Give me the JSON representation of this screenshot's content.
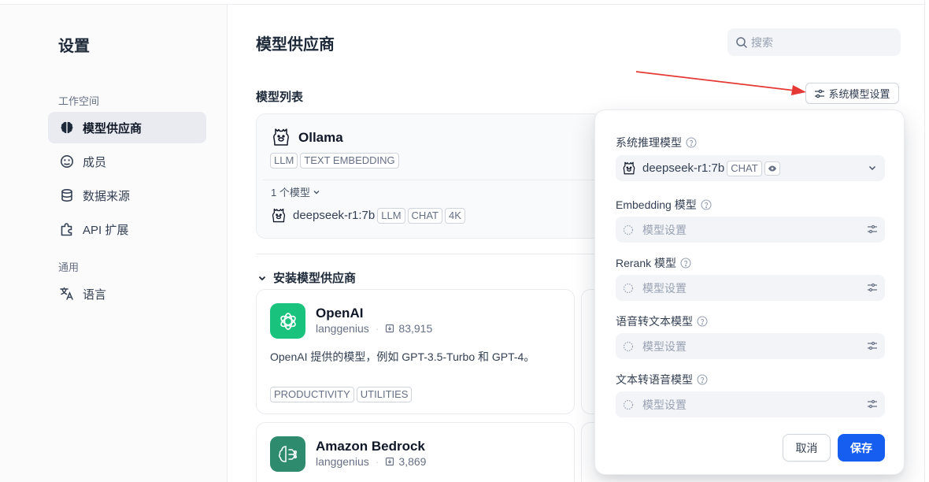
{
  "colors": {
    "accent": "#155eef",
    "arrow": "#e53935",
    "openai": "#19c37d",
    "bedrock": "#2e8b6e"
  },
  "sidebar": {
    "title": "设置",
    "group_workspace": "工作空间",
    "group_general": "通用",
    "items": [
      {
        "label": "模型供应商",
        "icon": "brain-icon"
      },
      {
        "label": "成员",
        "icon": "members-icon"
      },
      {
        "label": "数据来源",
        "icon": "database-icon"
      },
      {
        "label": "API 扩展",
        "icon": "puzzle-icon"
      },
      {
        "label": "语言",
        "icon": "translate-icon"
      }
    ]
  },
  "main": {
    "title": "模型供应商",
    "search_placeholder": "搜索",
    "model_list_label": "模型列表",
    "system_model_button": "系统模型设置",
    "ollama": {
      "name": "Ollama",
      "tags": [
        "LLM",
        "TEXT EMBEDDING"
      ],
      "model_count": "1 个模型",
      "model": {
        "name": "deepseek-r1:7b",
        "tags": [
          "LLM",
          "CHAT",
          "4K"
        ]
      }
    },
    "install_label": "安装模型供应商",
    "providers": [
      {
        "name": "OpenAI",
        "author": "langgenius",
        "downloads": "83,915",
        "description": "OpenAI 提供的模型，例如 GPT-3.5-Turbo 和 GPT-4。",
        "tags": [
          "PRODUCTIVITY",
          "UTILITIES"
        ]
      },
      {
        "name": "Amazon Bedrock",
        "author": "langgenius",
        "downloads": "3,869"
      }
    ]
  },
  "popover": {
    "reasoning": {
      "label": "系统推理模型",
      "model": "deepseek-r1:7b",
      "tag": "CHAT"
    },
    "embedding": {
      "label": "Embedding 模型",
      "placeholder": "模型设置"
    },
    "rerank": {
      "label": "Rerank 模型",
      "placeholder": "模型设置"
    },
    "stt": {
      "label": "语音转文本模型",
      "placeholder": "模型设置"
    },
    "tts": {
      "label": "文本转语音模型",
      "placeholder": "模型设置"
    },
    "cancel": "取消",
    "save": "保存"
  }
}
